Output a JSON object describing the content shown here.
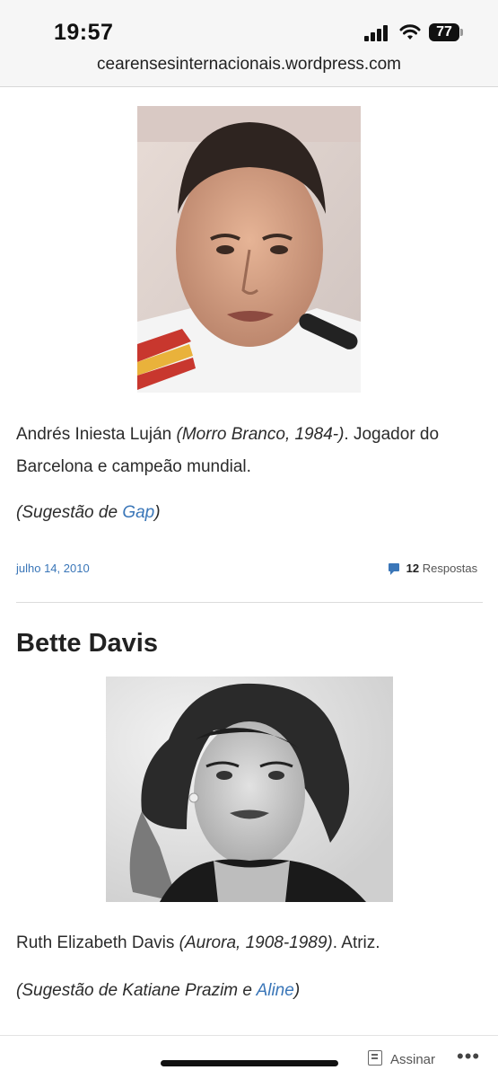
{
  "status_bar": {
    "time": "19:57",
    "battery": "77"
  },
  "browser": {
    "url": "cearensesinternacionais.wordpress.com"
  },
  "post1": {
    "name": "Andrés Iniesta Luján",
    "birth_info": "(Morro Branco, 1984-)",
    "description": ". Jogador do Barcelona e campeão mundial.",
    "suggestion_prefix": "(Sugestão de ",
    "suggestion_link": "Gap",
    "suggestion_suffix": ")",
    "date": "julho 14, 2010",
    "replies_count": "12",
    "replies_label": "Respostas"
  },
  "post2": {
    "title": "Bette Davis",
    "name": "Ruth Elizabeth Davis",
    "birth_info": "(Aurora, 1908-1989)",
    "description": ". Atriz.",
    "suggestion_prefix": "(Sugestão de Katiane Prazim e ",
    "suggestion_link": "Aline",
    "suggestion_suffix": ")"
  },
  "bottom_bar": {
    "subscribe_label": "Assinar",
    "more_label": "•••"
  },
  "colors": {
    "link": "#3a76b8",
    "text": "#2b2b2b"
  },
  "icons": [
    "signal-icon",
    "wifi-icon",
    "battery-icon",
    "comment-icon",
    "subscribe-icon",
    "more-icon"
  ]
}
